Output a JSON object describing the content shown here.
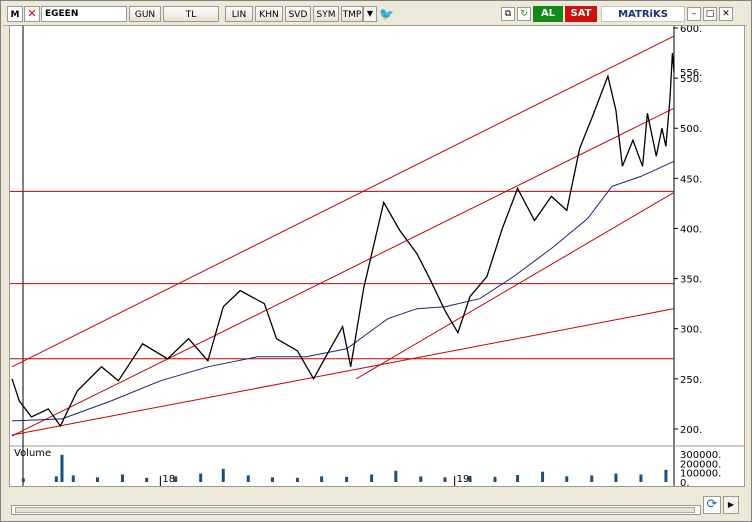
{
  "toolbar": {
    "m_label": "M",
    "symbol": "EGEEN",
    "buttons": [
      "GUN",
      "TL",
      "LIN",
      "KHN",
      "SVD",
      "SYM",
      "TMP"
    ],
    "al_label": "AL",
    "sat_label": "SAT",
    "brand": "MATRiKS"
  },
  "colors": {
    "price": "#000000",
    "moving_average": "#1a237e",
    "channel_lines": "#cc0000",
    "volume_bars": "#1a4f7a",
    "al_button": "#118a1a",
    "sat_button": "#cc1010"
  },
  "chart_data": {
    "type": "line",
    "title": "",
    "ylabel": "",
    "ylim": [
      185,
      600
    ],
    "y_ticks": [
      200,
      250,
      300,
      350,
      400,
      450,
      500,
      550,
      600
    ],
    "y_tick_labels": [
      "200.",
      "250.",
      "300.",
      "350.",
      "400.",
      "450.",
      "500.",
      "550.",
      "600."
    ],
    "last_price_label": "556.",
    "x_labels": [
      {
        "label": "18",
        "date": "2018-01-01"
      },
      {
        "label": "19",
        "date": "2019-01-01"
      }
    ],
    "x_range": [
      "2017-07-01",
      "2019-09-30"
    ],
    "series": [
      {
        "points": [
          {
            "x": "2017-07-01",
            "y": 250
          },
          {
            "x": "2017-07-10",
            "y": 228
          },
          {
            "x": "2017-07-25",
            "y": 212
          },
          {
            "x": "2017-08-15",
            "y": 220
          },
          {
            "x": "2017-08-30",
            "y": 203
          },
          {
            "x": "2017-09-20",
            "y": 238
          },
          {
            "x": "2017-10-20",
            "y": 262
          },
          {
            "x": "2017-11-10",
            "y": 248
          },
          {
            "x": "2017-12-10",
            "y": 285
          },
          {
            "x": "2018-01-10",
            "y": 270
          },
          {
            "x": "2018-02-05",
            "y": 290
          },
          {
            "x": "2018-03-01",
            "y": 268
          },
          {
            "x": "2018-03-20",
            "y": 322
          },
          {
            "x": "2018-04-10",
            "y": 338
          },
          {
            "x": "2018-05-10",
            "y": 325
          },
          {
            "x": "2018-05-25",
            "y": 290
          },
          {
            "x": "2018-06-20",
            "y": 278
          },
          {
            "x": "2018-07-10",
            "y": 250
          },
          {
            "x": "2018-07-25",
            "y": 272
          },
          {
            "x": "2018-08-15",
            "y": 302
          },
          {
            "x": "2018-08-25",
            "y": 262
          },
          {
            "x": "2018-09-10",
            "y": 340
          },
          {
            "x": "2018-10-05",
            "y": 426
          },
          {
            "x": "2018-10-25",
            "y": 398
          },
          {
            "x": "2018-11-15",
            "y": 375
          },
          {
            "x": "2018-12-01",
            "y": 350
          },
          {
            "x": "2018-12-20",
            "y": 318
          },
          {
            "x": "2019-01-05",
            "y": 296
          },
          {
            "x": "2019-01-20",
            "y": 332
          },
          {
            "x": "2019-02-10",
            "y": 352
          },
          {
            "x": "2019-03-01",
            "y": 400
          },
          {
            "x": "2019-03-20",
            "y": 440
          },
          {
            "x": "2019-04-10",
            "y": 408
          },
          {
            "x": "2019-05-01",
            "y": 432
          },
          {
            "x": "2019-05-20",
            "y": 418
          },
          {
            "x": "2019-06-05",
            "y": 480
          },
          {
            "x": "2019-06-20",
            "y": 510
          },
          {
            "x": "2019-07-10",
            "y": 552
          },
          {
            "x": "2019-07-20",
            "y": 518
          },
          {
            "x": "2019-07-28",
            "y": 462
          },
          {
            "x": "2019-08-10",
            "y": 488
          },
          {
            "x": "2019-08-22",
            "y": 462
          },
          {
            "x": "2019-08-28",
            "y": 515
          },
          {
            "x": "2019-09-08",
            "y": 472
          },
          {
            "x": "2019-09-15",
            "y": 500
          },
          {
            "x": "2019-09-20",
            "y": 482
          },
          {
            "x": "2019-09-25",
            "y": 530
          },
          {
            "x": "2019-09-28",
            "y": 575
          },
          {
            "x": "2019-09-30",
            "y": 556
          }
        ]
      },
      {
        "points": [
          {
            "x": "2017-07-01",
            "y": 208
          },
          {
            "x": "2017-09-01",
            "y": 210
          },
          {
            "x": "2017-11-01",
            "y": 228
          },
          {
            "x": "2018-01-01",
            "y": 248
          },
          {
            "x": "2018-03-01",
            "y": 262
          },
          {
            "x": "2018-05-01",
            "y": 272
          },
          {
            "x": "2018-07-01",
            "y": 272
          },
          {
            "x": "2018-08-20",
            "y": 280
          },
          {
            "x": "2018-10-10",
            "y": 310
          },
          {
            "x": "2018-11-15",
            "y": 320
          },
          {
            "x": "2018-12-20",
            "y": 322
          },
          {
            "x": "2019-02-01",
            "y": 330
          },
          {
            "x": "2019-03-15",
            "y": 352
          },
          {
            "x": "2019-05-01",
            "y": 380
          },
          {
            "x": "2019-06-15",
            "y": 410
          },
          {
            "x": "2019-07-15",
            "y": 442
          },
          {
            "x": "2019-08-20",
            "y": 452
          },
          {
            "x": "2019-09-30",
            "y": 467
          }
        ]
      }
    ],
    "channel_lines": [
      {
        "from": {
          "x": "2017-07-01",
          "y": 262
        },
        "to": {
          "x": "2019-09-30",
          "y": 592
        }
      },
      {
        "from": {
          "x": "2017-07-01",
          "y": 193
        },
        "to": {
          "x": "2019-09-30",
          "y": 520
        }
      },
      {
        "from": {
          "x": "2018-09-01",
          "y": 250
        },
        "to": {
          "x": "2019-09-30",
          "y": 436
        }
      },
      {
        "from": {
          "x": "2017-07-01",
          "y": 194
        },
        "to": {
          "x": "2019-09-30",
          "y": 320
        }
      }
    ],
    "horizontal_lines": [
      437,
      345,
      270
    ],
    "volume": {
      "label": "Volume",
      "ylim": [
        0,
        320000
      ],
      "y_tick_labels": [
        "300000.",
        "200000.",
        "100000.",
        "0."
      ],
      "y_ticks": [
        300000,
        200000,
        100000,
        0
      ],
      "bars": [
        {
          "x": "2017-07-15",
          "y": 40000
        },
        {
          "x": "2017-08-25",
          "y": 60000
        },
        {
          "x": "2017-09-01",
          "y": 290000
        },
        {
          "x": "2017-09-15",
          "y": 70000
        },
        {
          "x": "2017-10-15",
          "y": 50000
        },
        {
          "x": "2017-11-15",
          "y": 80000
        },
        {
          "x": "2017-12-15",
          "y": 45000
        },
        {
          "x": "2018-01-20",
          "y": 60000
        },
        {
          "x": "2018-02-20",
          "y": 90000
        },
        {
          "x": "2018-03-20",
          "y": 140000
        },
        {
          "x": "2018-04-20",
          "y": 70000
        },
        {
          "x": "2018-05-20",
          "y": 50000
        },
        {
          "x": "2018-06-20",
          "y": 45000
        },
        {
          "x": "2018-07-20",
          "y": 60000
        },
        {
          "x": "2018-08-20",
          "y": 55000
        },
        {
          "x": "2018-09-20",
          "y": 80000
        },
        {
          "x": "2018-10-20",
          "y": 120000
        },
        {
          "x": "2018-11-20",
          "y": 60000
        },
        {
          "x": "2018-12-20",
          "y": 50000
        },
        {
          "x": "2019-01-20",
          "y": 65000
        },
        {
          "x": "2019-02-20",
          "y": 55000
        },
        {
          "x": "2019-03-20",
          "y": 75000
        },
        {
          "x": "2019-04-20",
          "y": 110000
        },
        {
          "x": "2019-05-20",
          "y": 60000
        },
        {
          "x": "2019-06-20",
          "y": 70000
        },
        {
          "x": "2019-07-20",
          "y": 90000
        },
        {
          "x": "2019-08-20",
          "y": 80000
        },
        {
          "x": "2019-09-20",
          "y": 130000
        }
      ]
    }
  }
}
